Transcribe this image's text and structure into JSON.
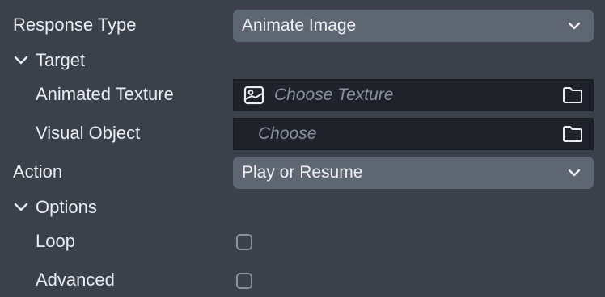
{
  "response_type": {
    "label": "Response Type",
    "value": "Animate Image"
  },
  "target": {
    "section_label": "Target",
    "animated_texture": {
      "label": "Animated Texture",
      "placeholder": "Choose Texture"
    },
    "visual_object": {
      "label": "Visual Object",
      "placeholder": "Choose"
    }
  },
  "action": {
    "label": "Action",
    "value": "Play or Resume"
  },
  "options": {
    "section_label": "Options",
    "loop": {
      "label": "Loop",
      "checked": false
    },
    "advanced": {
      "label": "Advanced",
      "checked": false
    }
  },
  "icons": {
    "section_toggle": "chevron-down-icon",
    "dropdown": "chevron-down-icon",
    "texture": "image-icon",
    "browse": "folder-icon"
  },
  "colors": {
    "background": "#3b414a",
    "dropdown_bg": "#5e6672",
    "field_bg": "#1f2329",
    "text": "#e9ecf0",
    "placeholder": "#8b919a"
  }
}
